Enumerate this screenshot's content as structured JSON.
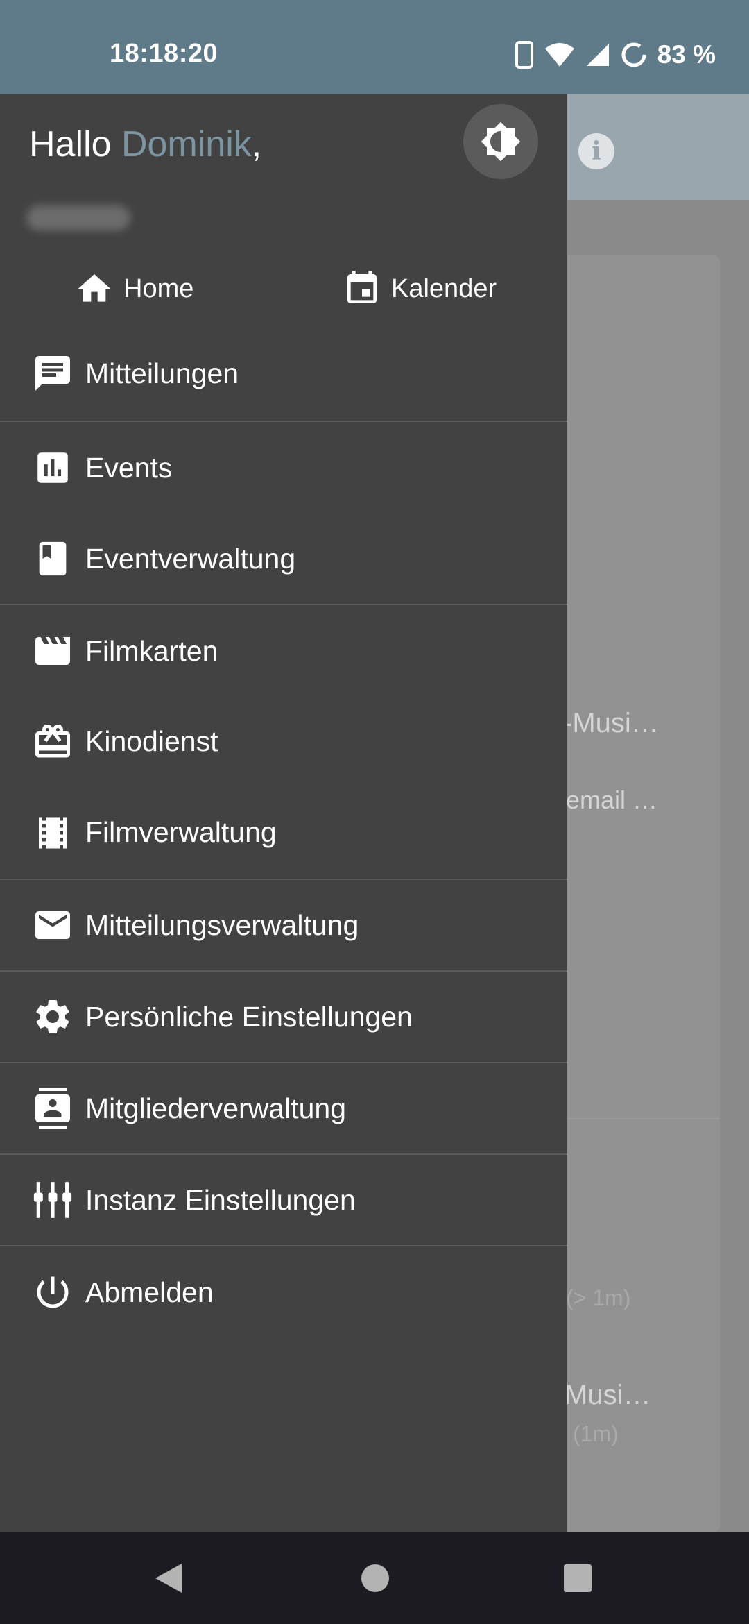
{
  "status_bar": {
    "time": "18:18:20",
    "battery_percent": "83 %",
    "icons": [
      "phone-vibrate-icon",
      "wifi-icon",
      "signal-icon",
      "battery-saver-icon"
    ]
  },
  "background": {
    "text_1": "-Musi…",
    "text_2": "email …",
    "text_3": "(> 1m)",
    "text_4": "Musi…",
    "text_5": "(1m)"
  },
  "drawer": {
    "greeting": "Hallo",
    "user_name": "Dominik",
    "greeting_suffix": ",",
    "theme_toggle_icon": "brightness-icon",
    "quick_links": [
      {
        "label": "Home",
        "icon": "home-icon"
      },
      {
        "label": "Kalender",
        "icon": "calendar-icon"
      }
    ],
    "menu": [
      {
        "label": "Mitteilungen",
        "icon": "message-icon"
      },
      {
        "label": "Events",
        "icon": "chart-icon"
      },
      {
        "label": "Eventverwaltung",
        "icon": "book-icon"
      },
      {
        "label": "Filmkarten",
        "icon": "clapperboard-icon"
      },
      {
        "label": "Kinodienst",
        "icon": "gift-card-icon"
      },
      {
        "label": "Filmverwaltung",
        "icon": "film-icon"
      },
      {
        "label": "Mitteilungsverwaltung",
        "icon": "mail-icon"
      },
      {
        "label": "Persönliche Einstellungen",
        "icon": "gear-icon"
      },
      {
        "label": "Mitgliederverwaltung",
        "icon": "contacts-icon"
      },
      {
        "label": "Instanz Einstellungen",
        "icon": "equalizer-icon"
      },
      {
        "label": "Abmelden",
        "icon": "power-icon"
      }
    ]
  },
  "colors": {
    "status_bar": "#5f7b8a",
    "drawer_bg": "#424242",
    "accent_name": "#7d95a3",
    "nav_bar": "#1c1b21"
  }
}
